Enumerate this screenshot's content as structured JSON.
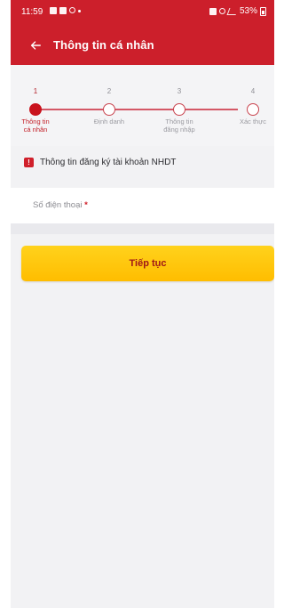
{
  "status_bar": {
    "time": "11:59",
    "battery": "53%"
  },
  "header": {
    "title": "Thông tin cá nhân"
  },
  "stepper": {
    "steps": [
      {
        "number": "1",
        "label_line1": "Thông tin",
        "label_line2": "cá nhân",
        "active": true
      },
      {
        "number": "2",
        "label_line1": "Định danh",
        "label_line2": "",
        "active": false
      },
      {
        "number": "3",
        "label_line1": "Thông tin",
        "label_line2": "đăng nhập",
        "active": false
      },
      {
        "number": "4",
        "label_line1": "Xác thực",
        "label_line2": "",
        "active": false
      }
    ]
  },
  "form": {
    "section_title": "Thông tin đăng ký tài khoản NHDT",
    "phone": {
      "label": "Số điện thoại",
      "required_mark": "*",
      "value": ""
    },
    "continue_label": "Tiếp tục"
  },
  "colors": {
    "brand_red": "#cc1f2b",
    "button_yellow": "#ffc80a",
    "background": "#f2f2f4"
  }
}
